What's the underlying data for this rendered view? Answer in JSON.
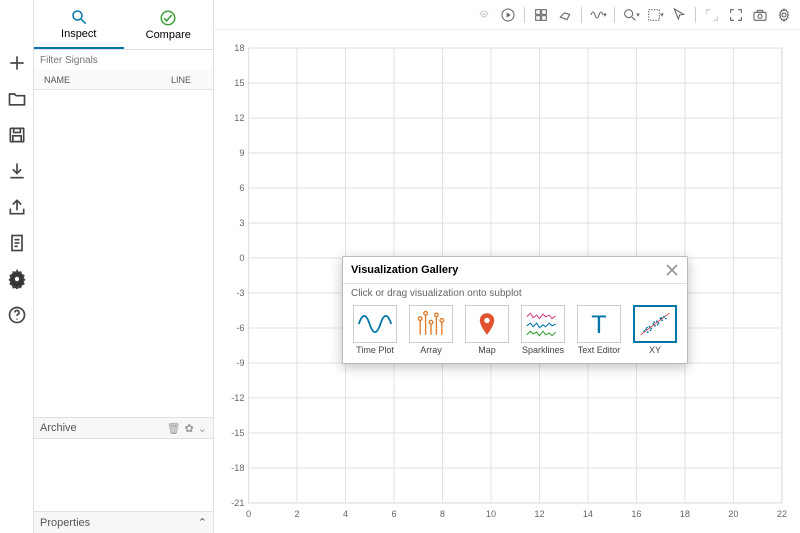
{
  "tabs": {
    "inspect": "Inspect",
    "compare": "Compare"
  },
  "filter": {
    "placeholder": "Filter Signals"
  },
  "table": {
    "col_name": "NAME",
    "col_line": "LINE"
  },
  "archive": {
    "label": "Archive"
  },
  "properties": {
    "label": "Properties"
  },
  "gallery": {
    "title": "Visualization Gallery",
    "hint": "Click or drag visualization onto subplot",
    "items": [
      {
        "label": "Time Plot"
      },
      {
        "label": "Array"
      },
      {
        "label": "Map"
      },
      {
        "label": "Sparklines"
      },
      {
        "label": "Text Editor"
      },
      {
        "label": "XY"
      }
    ]
  },
  "chart_data": {
    "type": "line",
    "title": "",
    "xlabel": "",
    "ylabel": "",
    "x_ticks": [
      0,
      2,
      4,
      6,
      8,
      10,
      12,
      14,
      16,
      18,
      20,
      22
    ],
    "y_ticks": [
      -21,
      -18,
      -15,
      -12,
      -9,
      -6,
      -3,
      0,
      3,
      6,
      9,
      12,
      15,
      18
    ],
    "xlim": [
      0,
      22
    ],
    "ylim": [
      -21,
      18
    ],
    "series": []
  }
}
